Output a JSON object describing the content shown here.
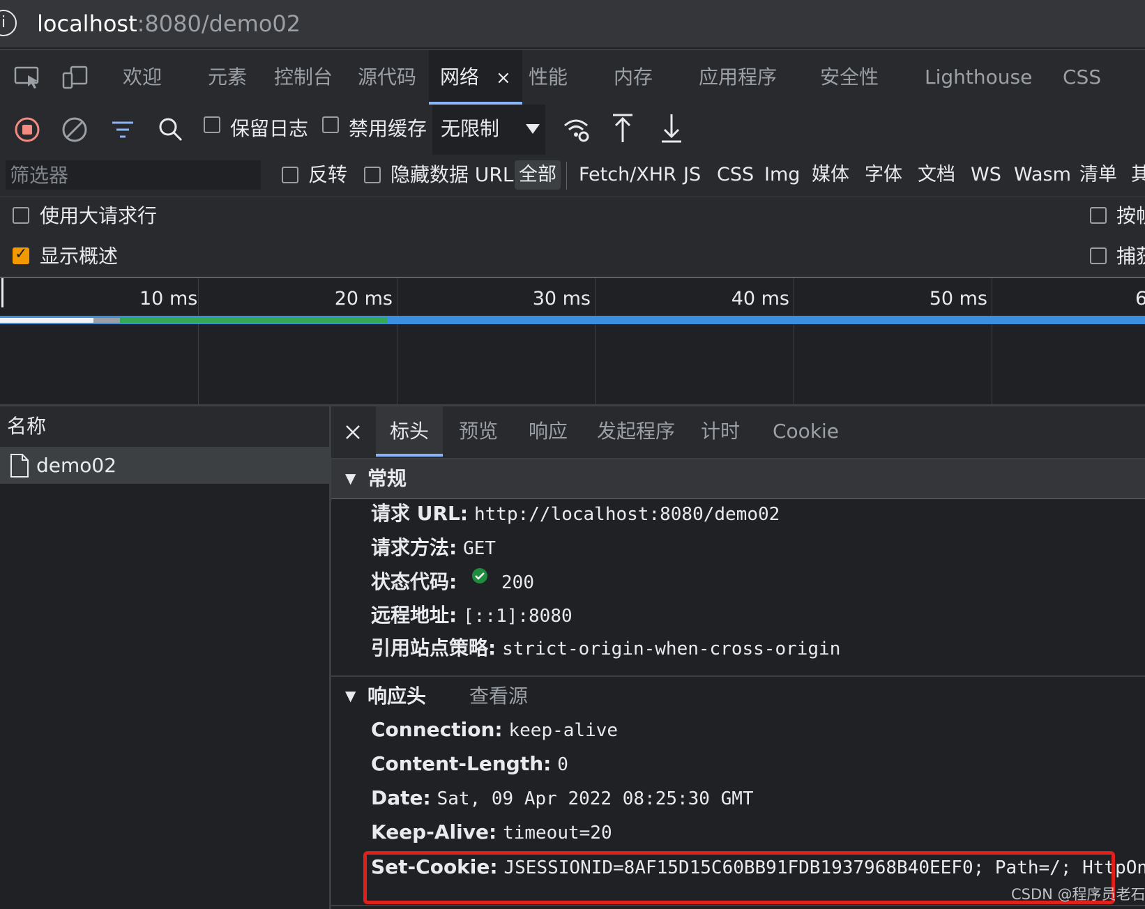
{
  "address_bar": {
    "host": "localhost",
    "path": ":8080/demo02"
  },
  "devtools_tabs": [
    {
      "label": "欢迎"
    },
    {
      "label": "元素"
    },
    {
      "label": "控制台"
    },
    {
      "label": "源代码"
    },
    {
      "label": "网络",
      "active": true
    },
    {
      "label": "性能"
    },
    {
      "label": "内存"
    },
    {
      "label": "应用程序"
    },
    {
      "label": "安全性"
    },
    {
      "label": "Lighthouse"
    },
    {
      "label": "CSS"
    }
  ],
  "tab_close": "×",
  "toolbar": {
    "preserve_log": "保留日志",
    "disable_cache": "禁用缓存",
    "throttling": "无限制"
  },
  "filter": {
    "placeholder": "筛选器",
    "invert": "反转",
    "hide_data_urls": "隐藏数据 URL",
    "types": [
      "全部",
      "Fetch/XHR",
      "JS",
      "CSS",
      "Img",
      "媒体",
      "字体",
      "文档",
      "WS",
      "Wasm",
      "清单",
      "其"
    ]
  },
  "options": {
    "big_rows": "使用大请求行",
    "show_overview": "显示概述",
    "right_top": "按帧",
    "right_bottom": "捕获"
  },
  "overview": {
    "ticks": [
      "10 ms",
      "20 ms",
      "30 ms",
      "40 ms",
      "50 ms",
      "6"
    ]
  },
  "request_list": {
    "header": "名称",
    "items": [
      "demo02"
    ]
  },
  "details": {
    "tabs": [
      "标头",
      "预览",
      "响应",
      "发起程序",
      "计时",
      "Cookie"
    ],
    "general": {
      "title": "常规",
      "rows": [
        {
          "key": "请求 URL:",
          "value": "http://localhost:8080/demo02"
        },
        {
          "key": "请求方法:",
          "value": "GET"
        },
        {
          "key": "状态代码:",
          "value": "200"
        },
        {
          "key": "远程地址:",
          "value": "[::1]:8080"
        },
        {
          "key": "引用站点策略:",
          "value": "strict-origin-when-cross-origin"
        }
      ]
    },
    "response_headers": {
      "title": "响应头",
      "view_source": "查看源",
      "rows": [
        {
          "key": "Connection:",
          "value": "keep-alive"
        },
        {
          "key": "Content-Length:",
          "value": "0"
        },
        {
          "key": "Date:",
          "value": "Sat, 09 Apr 2022 08:25:30 GMT"
        },
        {
          "key": "Keep-Alive:",
          "value": "timeout=20"
        },
        {
          "key": "Set-Cookie:",
          "value": "JSESSIONID=8AF15D15C60BB91FDB1937968B40EEF0; Path=/; HttpOnly"
        }
      ]
    }
  },
  "watermark": "CSDN @程序员老石",
  "colors": {
    "accent": "#8ab4f8",
    "highlight_box": "#e0201a",
    "checkbox_checked": "#f29900",
    "status_ok": "#1e8e3e"
  }
}
